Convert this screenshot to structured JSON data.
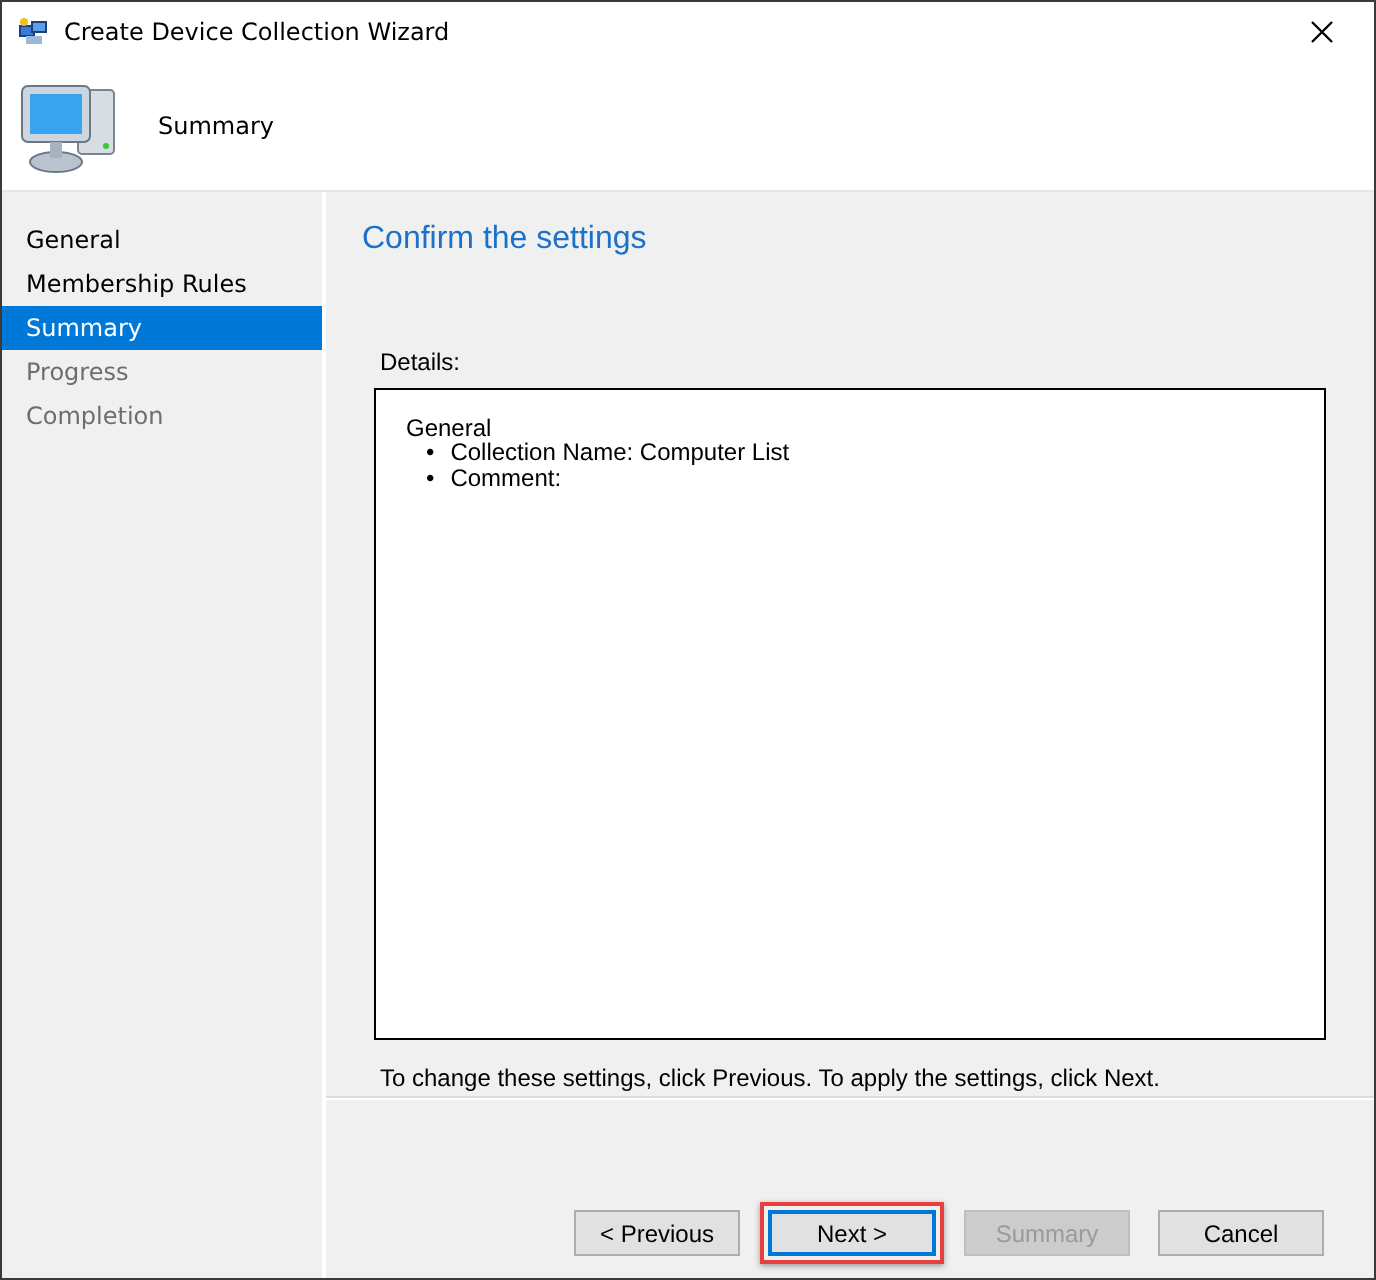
{
  "window": {
    "title": "Create Device Collection Wizard"
  },
  "header": {
    "title": "Summary"
  },
  "steps": [
    {
      "label": "General",
      "selected": false,
      "disabled": false
    },
    {
      "label": "Membership Rules",
      "selected": false,
      "disabled": false
    },
    {
      "label": "Summary",
      "selected": true,
      "disabled": false
    },
    {
      "label": "Progress",
      "selected": false,
      "disabled": true
    },
    {
      "label": "Completion",
      "selected": false,
      "disabled": true
    }
  ],
  "page": {
    "heading": "Confirm the settings",
    "details_label": "Details:",
    "details": {
      "section": "General",
      "bullet": "•",
      "items": [
        "Collection Name: Computer List",
        "Comment:"
      ]
    },
    "hint": "To change these settings, click Previous. To apply the settings, click Next."
  },
  "buttons": [
    {
      "label": "< Previous",
      "default": false,
      "disabled": false,
      "highlighted": false
    },
    {
      "label": "Next >",
      "default": true,
      "disabled": false,
      "highlighted": true
    },
    {
      "label": "Summary",
      "default": false,
      "disabled": true,
      "highlighted": false
    },
    {
      "label": "Cancel",
      "default": false,
      "disabled": false,
      "highlighted": false
    }
  ]
}
